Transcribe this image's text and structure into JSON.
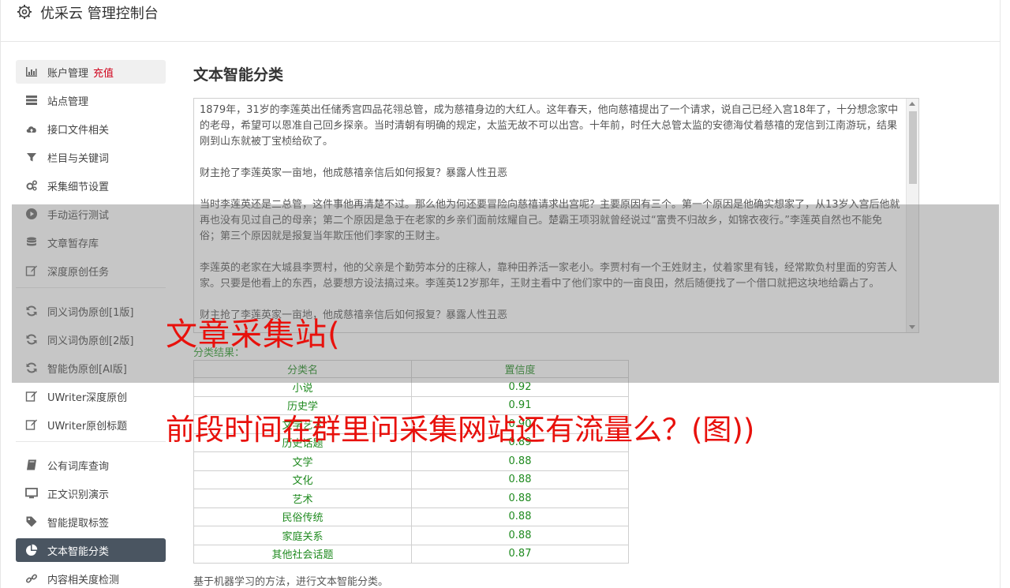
{
  "app": {
    "title": "优采云 管理控制台"
  },
  "sidebar": {
    "group1": [
      {
        "label": "账户管理",
        "badge": "充值",
        "icon": "bar-chart-icon"
      },
      {
        "label": "站点管理",
        "icon": "server-icon"
      },
      {
        "label": "接口文件相关",
        "icon": "cloud-upload-icon"
      },
      {
        "label": "栏目与关键词",
        "icon": "filter-icon"
      },
      {
        "label": "采集细节设置",
        "icon": "gears-icon"
      },
      {
        "label": "手动运行测试",
        "icon": "play-circle-icon"
      },
      {
        "label": "文章暂存库",
        "icon": "database-icon"
      },
      {
        "label": "深度原创任务",
        "icon": "edit-icon"
      }
    ],
    "group2": [
      {
        "label": "同义词伪原创[1版]",
        "icon": "refresh-icon"
      },
      {
        "label": "同义词伪原创[2版]",
        "icon": "refresh-icon"
      },
      {
        "label": "智能伪原创[AI版]",
        "icon": "refresh-icon"
      },
      {
        "label": "UWriter深度原创",
        "icon": "edit-icon"
      },
      {
        "label": "UWriter原创标题",
        "icon": "edit-icon"
      }
    ],
    "group3": [
      {
        "label": "公有词库查询",
        "icon": "book-icon"
      },
      {
        "label": "正文识别演示",
        "icon": "monitor-icon"
      },
      {
        "label": "智能提取标签",
        "icon": "tag-icon"
      },
      {
        "label": "文本智能分类",
        "icon": "pie-chart-icon",
        "active": true
      },
      {
        "label": "内容相关度检测",
        "icon": "link-icon"
      }
    ]
  },
  "main": {
    "title": "文本智能分类",
    "text_paragraphs": [
      "1879年，31岁的李莲英出任储秀宫四品花翎总管，成为慈禧身边的大红人。这年春天，他向慈禧提出了一个请求，说自己已经入宫18年了，十分想念家中的老母，希望可以恩准自己回乡探亲。当时清朝有明确的规定，太监无故不可以出宫。十年前，时任大总管太监的安德海仗着慈禧的宠信到江南游玩，结果刚到山东就被丁宝桢给砍了。",
      "财主抢了李莲英家一亩地，他成慈禧亲信后如何报复？暴露人性丑恶",
      "当时李莲英还是二总管，这件事他再清楚不过。那么他为何还要冒险向慈禧请求出宫呢？主要原因有三个。第一个原因是他确实想家了，从13岁入宫后他就再也没有见过自己的母亲；第二个原因是急于在老家的乡亲们面前炫耀自己。楚霸王项羽就曾经说过“富贵不归故乡，如锦衣夜行。”李莲英自然也不能免俗；第三个原因就是报复当年欺压他们李家的王财主。",
      "李莲英的老家在大城县李贾村，他的父亲是个勤劳本分的庄稼人，靠种田养活一家老小。李贾村有一个王姓财主，仗着家里有钱，经常欺负村里面的穷苦人家。只要是他看上的东西，总要想方设法搞过来。李莲英12岁那年，王财主看中了他们家中的一亩良田，然后随便找了一个借口就把这块地给霸占了。",
      "财主抢了李莲英家一亩地，他成慈禧亲信后如何报复？暴露人性丑恶"
    ],
    "result_label": "分类结果：",
    "table": {
      "headers": [
        "分类名",
        "置信度"
      ],
      "rows": [
        [
          "小说",
          "0.92"
        ],
        [
          "历史学",
          "0.91"
        ],
        [
          "文学艺术",
          "0.90"
        ],
        [
          "历史话题",
          "0.89"
        ],
        [
          "文学",
          "0.88"
        ],
        [
          "文化",
          "0.88"
        ],
        [
          "艺术",
          "0.88"
        ],
        [
          "民俗传统",
          "0.88"
        ],
        [
          "家庭关系",
          "0.88"
        ],
        [
          "其他社会话题",
          "0.87"
        ]
      ]
    },
    "footer_note": "基于机器学习的方法，进行文本智能分类。"
  },
  "overlay": {
    "headline1": "文章采集站(",
    "headline2": "前段时间在群里问采集网站还有流量么？(图))"
  },
  "colors": {
    "active_bg": "#4a5561",
    "recharge": "#d0021b",
    "result_green": "#1f8a1f",
    "headline_red": "#e8110c"
  }
}
